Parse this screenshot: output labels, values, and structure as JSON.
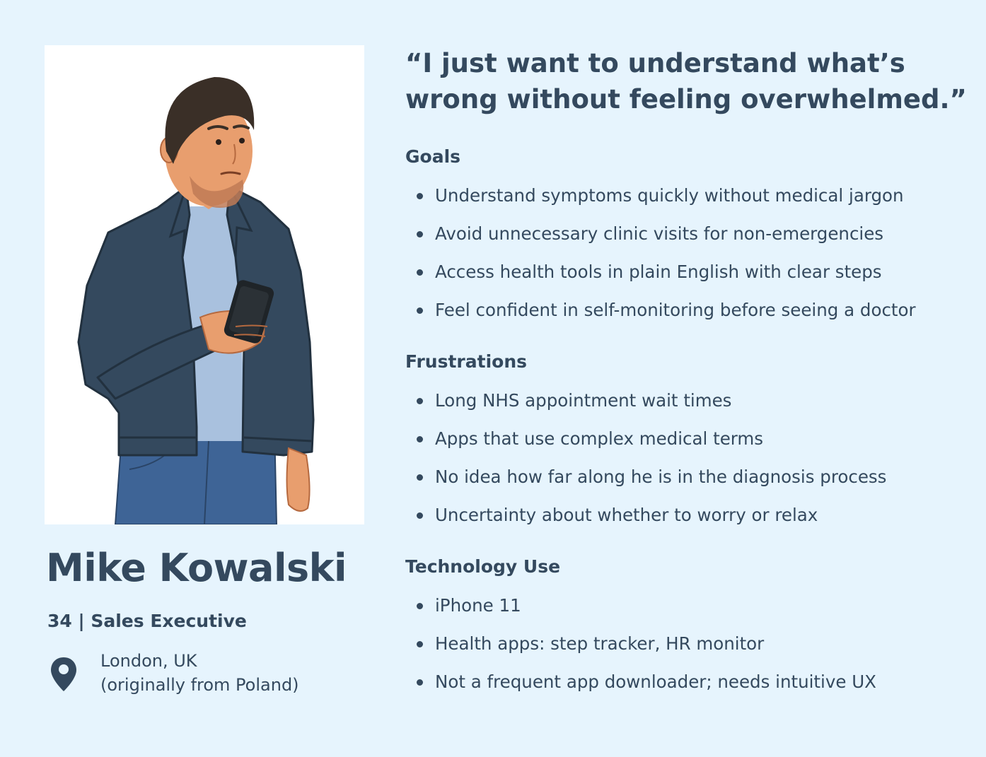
{
  "persona": {
    "name": "Mike Kowalski",
    "role_line": "34 | Sales Executive",
    "location_line1": "London, UK",
    "location_line2": "(originally from Poland)",
    "location_icon": "map-pin-icon",
    "illustration": "man-holding-phone-illustration"
  },
  "quote": {
    "line1": "“I just want to understand what’s",
    "line2": "wrong without feeling overwhelmed.”"
  },
  "sections": {
    "goals": {
      "title": "Goals",
      "items": [
        "Understand symptoms quickly without medical jargon",
        "Avoid unnecessary clinic visits for non-emergencies",
        "Access health tools in plain English with clear steps",
        "Feel confident in self-monitoring before seeing a doctor"
      ]
    },
    "frustrations": {
      "title": "Frustrations",
      "items": [
        "Long NHS appointment wait times",
        "Apps that use complex medical terms",
        "No idea how far along he is in the diagnosis process",
        "Uncertainty about whether to worry or relax"
      ]
    },
    "technology": {
      "title": "Technology Use",
      "items": [
        "iPhone 11",
        "Health apps: step tracker, HR monitor",
        "Not a frequent app downloader; needs intuitive UX"
      ]
    }
  },
  "colors": {
    "background": "#e6f4fd",
    "text": "#34495e",
    "jacket": "#34495e",
    "shirt": "#a9c1de",
    "jeans": "#3e6496",
    "skin": "#e89e6e",
    "hair": "#3a2f27"
  }
}
